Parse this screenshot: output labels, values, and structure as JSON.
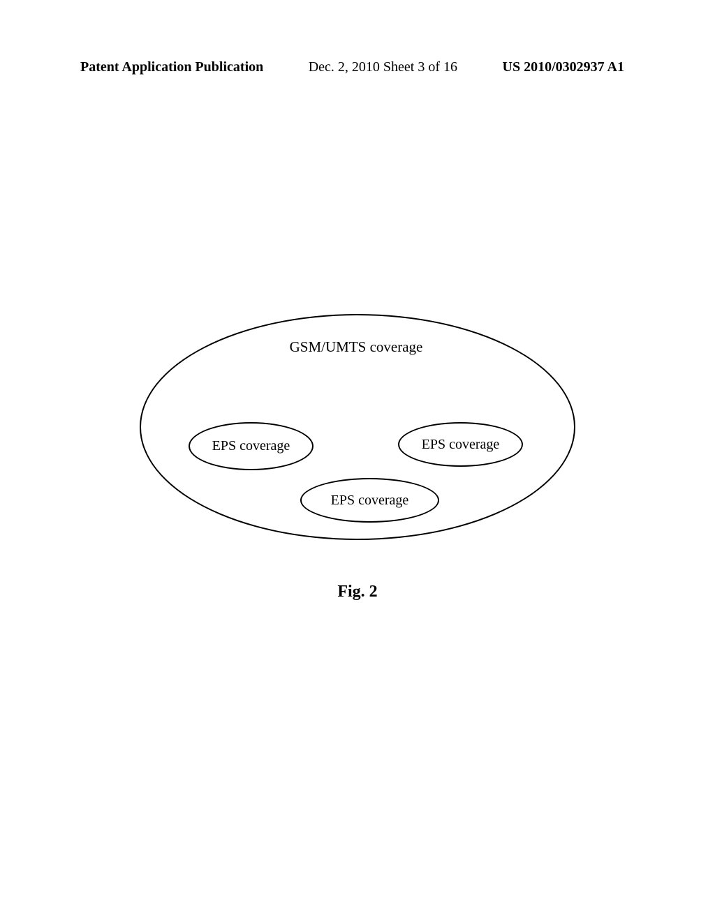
{
  "header": {
    "left": "Patent Application Publication",
    "center": "Dec. 2, 2010  Sheet 3 of 16",
    "right": "US 2010/0302937 A1"
  },
  "diagram": {
    "outer_label": "GSM/UMTS coverage",
    "eps_labels": {
      "eps1": "EPS coverage",
      "eps2": "EPS coverage",
      "eps3": "EPS coverage"
    }
  },
  "figure_label": "Fig. 2"
}
